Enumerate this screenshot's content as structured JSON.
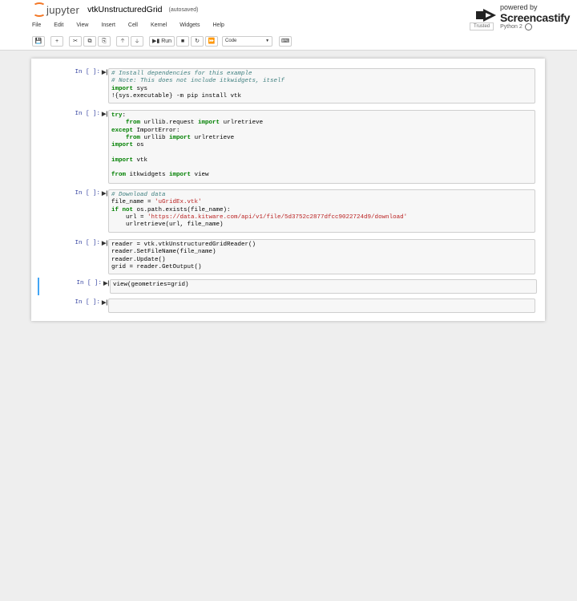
{
  "header": {
    "brand": "jupyter",
    "notebook_title": "vtkUnstructuredGrid",
    "autosave_status": "(autosaved)",
    "trusted_label": "Trusted",
    "kernel_name": "Python 2"
  },
  "screencastify": {
    "powered_by": "powered by",
    "name": "Screencastify"
  },
  "menu": [
    "File",
    "Edit",
    "View",
    "Insert",
    "Cell",
    "Kernel",
    "Widgets",
    "Help"
  ],
  "toolbar": {
    "run_label": "Run",
    "cell_type": "Code",
    "icons": [
      "save-icon",
      "add-cell-icon",
      "cut-icon",
      "copy-icon",
      "paste-icon",
      "move-up-icon",
      "move-down-icon",
      "run-icon",
      "stop-icon",
      "restart-icon",
      "fast-forward-icon",
      "keyboard-icon"
    ]
  },
  "cells": [
    {
      "prompt": "In [ ]:",
      "run_icon": "run-cell-icon",
      "lines": [
        "# Install dependencies for this example",
        "# Note: This does not include itkwidgets, itself",
        "import sys",
        "!{sys.executable} -m pip install vtk"
      ]
    },
    {
      "prompt": "In [ ]:",
      "run_icon": "run-cell-icon",
      "lines": [
        "try:",
        "    from urllib.request import urlretrieve",
        "except ImportError:",
        "    from urllib import urlretrieve",
        "import os",
        "",
        "import vtk",
        "",
        "from itkwidgets import view"
      ]
    },
    {
      "prompt": "In [ ]:",
      "run_icon": "run-cell-icon",
      "lines": [
        "# Download data",
        "file_name = 'uGridEx.vtk'",
        "if not os.path.exists(file_name):",
        "    url = 'https://data.kitware.com/api/v1/file/5d3752c2877dfcc9022724d9/download'",
        "    urlretrieve(url, file_name)"
      ]
    },
    {
      "prompt": "In [ ]:",
      "run_icon": "run-cell-icon",
      "lines": [
        "reader = vtk.vtkUnstructuredGridReader()",
        "reader.SetFileName(file_name)",
        "reader.Update()",
        "grid = reader.GetOutput()"
      ]
    },
    {
      "prompt": "In [ ]:",
      "run_icon": "run-cell-icon",
      "lines": [
        "view(geometries=grid)"
      ]
    },
    {
      "prompt": "In [ ]:",
      "run_icon": "run-cell-icon",
      "lines": [
        ""
      ]
    }
  ]
}
